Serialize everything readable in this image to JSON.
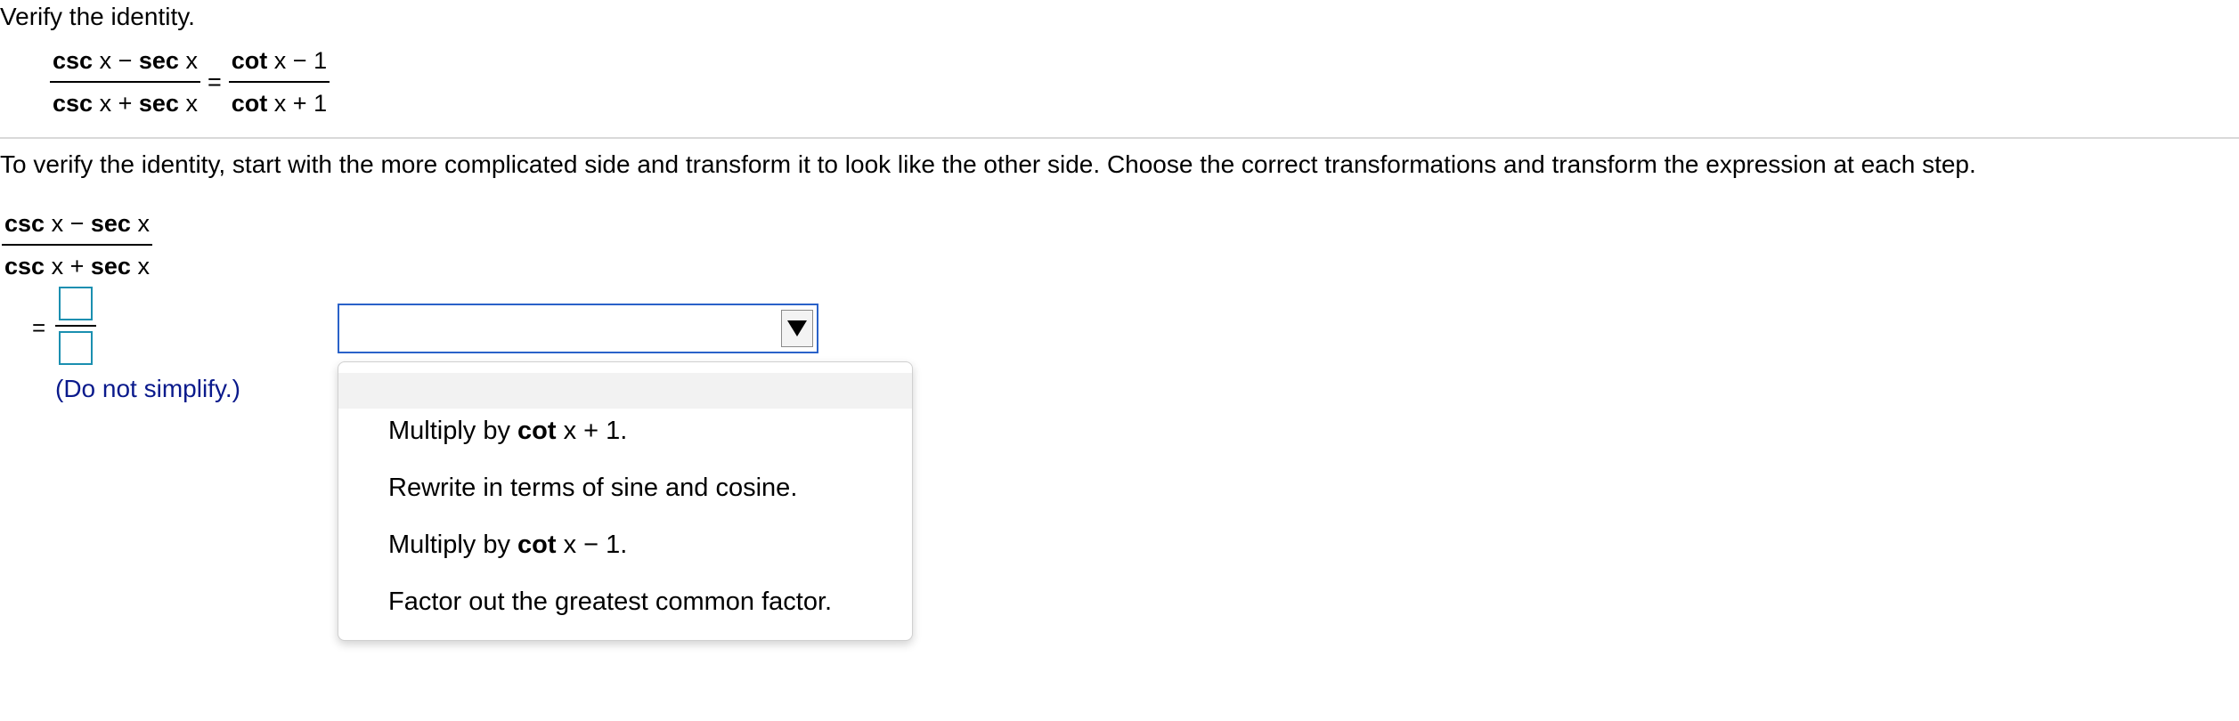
{
  "problem": {
    "title": "Verify the identity.",
    "lhs": {
      "num_t1_fn": "csc",
      "num_t1_var": "x",
      "num_op": "−",
      "num_t2_fn": "sec",
      "num_t2_var": "x",
      "den_t1_fn": "csc",
      "den_t1_var": "x",
      "den_op": "+",
      "den_t2_fn": "sec",
      "den_t2_var": "x"
    },
    "equals": "=",
    "rhs": {
      "num_fn": "cot",
      "num_var": "x",
      "num_op": "−",
      "num_const": "1",
      "den_fn": "cot",
      "den_var": "x",
      "den_op": "+",
      "den_const": "1"
    }
  },
  "instructions": "To verify the identity, start with the more complicated side and transform it to look like the other side. Choose the correct transformations and transform the expression at each step.",
  "work": {
    "expr": {
      "num_t1_fn": "csc",
      "num_t1_var": "x",
      "num_op": "−",
      "num_t2_fn": "sec",
      "num_t2_var": "x",
      "den_t1_fn": "csc",
      "den_t1_var": "x",
      "den_op": "+",
      "den_t2_fn": "sec",
      "den_t2_var": "x"
    },
    "equals": "=",
    "numerator_value": "",
    "denominator_value": "",
    "hint": "(Do not simplify.)"
  },
  "dropdown": {
    "selected": "",
    "options": [
      {
        "pre": "Multiply by ",
        "fn": "cot",
        "post": " x + 1."
      },
      {
        "text": "Rewrite in terms of sine and cosine."
      },
      {
        "pre": "Multiply by ",
        "fn": "cot",
        "post": " x − 1."
      },
      {
        "text": "Factor out the greatest common factor."
      }
    ]
  },
  "colors": {
    "input_border": "#1a8fb0",
    "select_border": "#2a62c9",
    "hint_text": "#0a1a8c",
    "menu_highlight": "#f2f2f2"
  }
}
